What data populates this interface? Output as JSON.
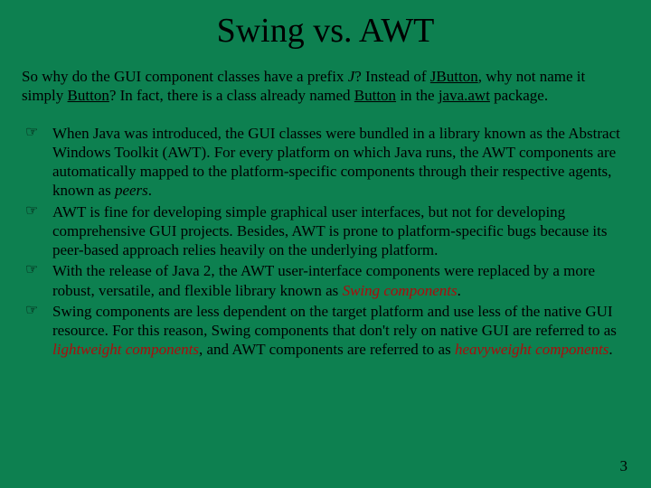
{
  "title": "Swing vs. AWT",
  "intro": {
    "t0": "So why do the GUI component classes have a prefix ",
    "j": "J",
    "t1": "? Instead of ",
    "u1": "JButton",
    "t2": ", why not name it simply ",
    "u2": "Button",
    "t3": "? In fact, there is a class already named ",
    "u3": "Button",
    "t4": " in the ",
    "u4": "java.awt",
    "t5": " package."
  },
  "bullets": {
    "b0": {
      "t0": "When Java was introduced, the GUI classes were bundled in a library known as the Abstract Windows Toolkit (AWT). For every platform on which Java runs, the AWT components are automatically mapped to the platform-specific components through their respective agents, known as ",
      "i0": "peers",
      "t1": "."
    },
    "b1": {
      "t0": "AWT is fine for developing simple graphical user interfaces, but not for developing comprehensive GUI projects. Besides, AWT is prone to platform-specific bugs because its peer-based approach relies heavily on the underlying platform."
    },
    "b2": {
      "t0": "With the release of Java 2, the AWT user-interface components were replaced by a more robust, versatile, and flexible library known as ",
      "s0": "Swing components",
      "t1": "."
    },
    "b3": {
      "t0": "Swing components are less dependent on the target platform and use less of the native GUI resource. For this reason, Swing components that don't rely on native GUI are referred to as ",
      "s0": "lightweight components",
      "t1": ", and AWT components are referred to as ",
      "s1": "heavyweight components",
      "t2": "."
    }
  },
  "pagenum": "3"
}
